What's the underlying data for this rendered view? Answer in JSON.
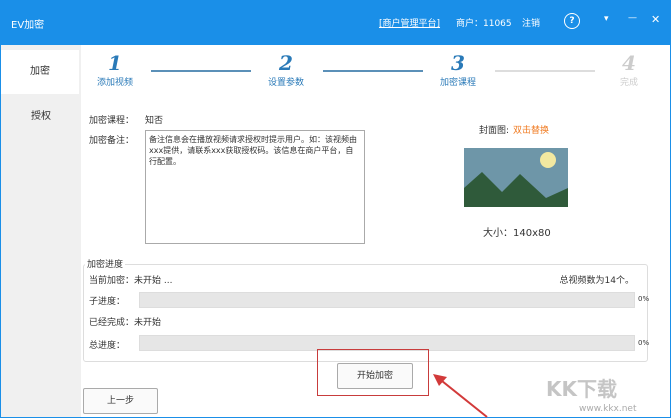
{
  "title": {
    "app": "EV加密",
    "portal": "[商户管理平台]",
    "merchant": "商户：11065",
    "logout": "注销"
  },
  "sidebar": {
    "items": [
      {
        "label": "加密"
      },
      {
        "label": "授权"
      }
    ]
  },
  "steps": [
    {
      "n": "1",
      "label": "添加视频"
    },
    {
      "n": "2",
      "label": "设置参数"
    },
    {
      "n": "3",
      "label": "加密课程"
    },
    {
      "n": "4",
      "label": "完成"
    }
  ],
  "form": {
    "course_label": "加密课程：",
    "course_value": "知否",
    "note_label": "加密备注：",
    "note_value": "备注信息会在播放视频请求授权时提示用户。如：该视频由xxx提供，请联系xxx获取授权码。该信息在商户平台，自行配置。"
  },
  "cover": {
    "label": "封面图:",
    "action": "双击替换",
    "size": "大小：140x80"
  },
  "progress": {
    "title": "加密进度",
    "current_label": "当前加密：未开始 ...",
    "total_videos": "总视频数为14个。",
    "sub_label": "子进度：",
    "sub_pct": "0%",
    "sub_value": 0,
    "done_label": "已经完成：未开始",
    "total_label": "总进度：",
    "total_pct": "0%",
    "total_value": 0
  },
  "buttons": {
    "start": "开始加密",
    "prev": "上一步"
  },
  "watermark": {
    "text": "KK下载",
    "url": "www.kkx.net"
  }
}
